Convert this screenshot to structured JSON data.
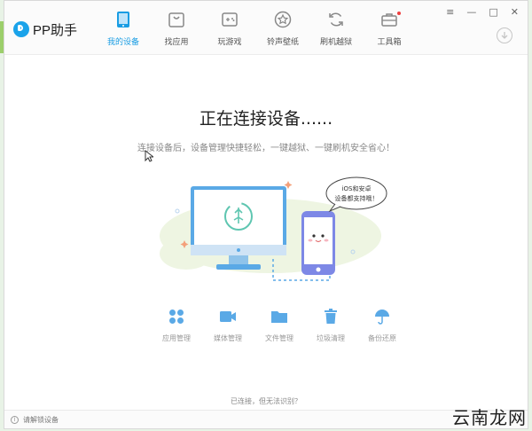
{
  "app": {
    "logo_text": "PP助手"
  },
  "nav": [
    {
      "label": "我的设备",
      "icon": "phone-icon",
      "active": true
    },
    {
      "label": "找应用",
      "icon": "bag-icon",
      "active": false
    },
    {
      "label": "玩游戏",
      "icon": "gamepad-icon",
      "active": false
    },
    {
      "label": "铃声壁纸",
      "icon": "star-icon",
      "active": false
    },
    {
      "label": "刷机越狱",
      "icon": "refresh-icon",
      "active": false
    },
    {
      "label": "工具箱",
      "icon": "toolbox-icon",
      "active": false,
      "badge": true
    }
  ],
  "window_controls": {
    "menu": "≡",
    "minimize": "—",
    "maximize": "□",
    "close": "✕"
  },
  "main": {
    "title": "正在连接设备......",
    "subtitle": "连接设备后，设备管理快捷轻松，一键越狱、一键刷机安全省心！",
    "bubble_line1": "iOS和安卓",
    "bubble_line2": "设备都支持哦！"
  },
  "features": [
    {
      "label": "应用管理",
      "icon": "apps-grid-icon"
    },
    {
      "label": "媒体管理",
      "icon": "video-camera-icon"
    },
    {
      "label": "文件管理",
      "icon": "folder-icon"
    },
    {
      "label": "垃圾清理",
      "icon": "trash-icon"
    },
    {
      "label": "备份还原",
      "icon": "umbrella-icon"
    }
  ],
  "bottom_link": "已连接，但无法识别？",
  "status": {
    "icon_text": "i",
    "text": "请解锁设备"
  },
  "watermark": "云南龙网",
  "colors": {
    "accent": "#1a9de3",
    "icon_gray": "#9a9a9a",
    "feature_blue": "#5aa9e6"
  }
}
